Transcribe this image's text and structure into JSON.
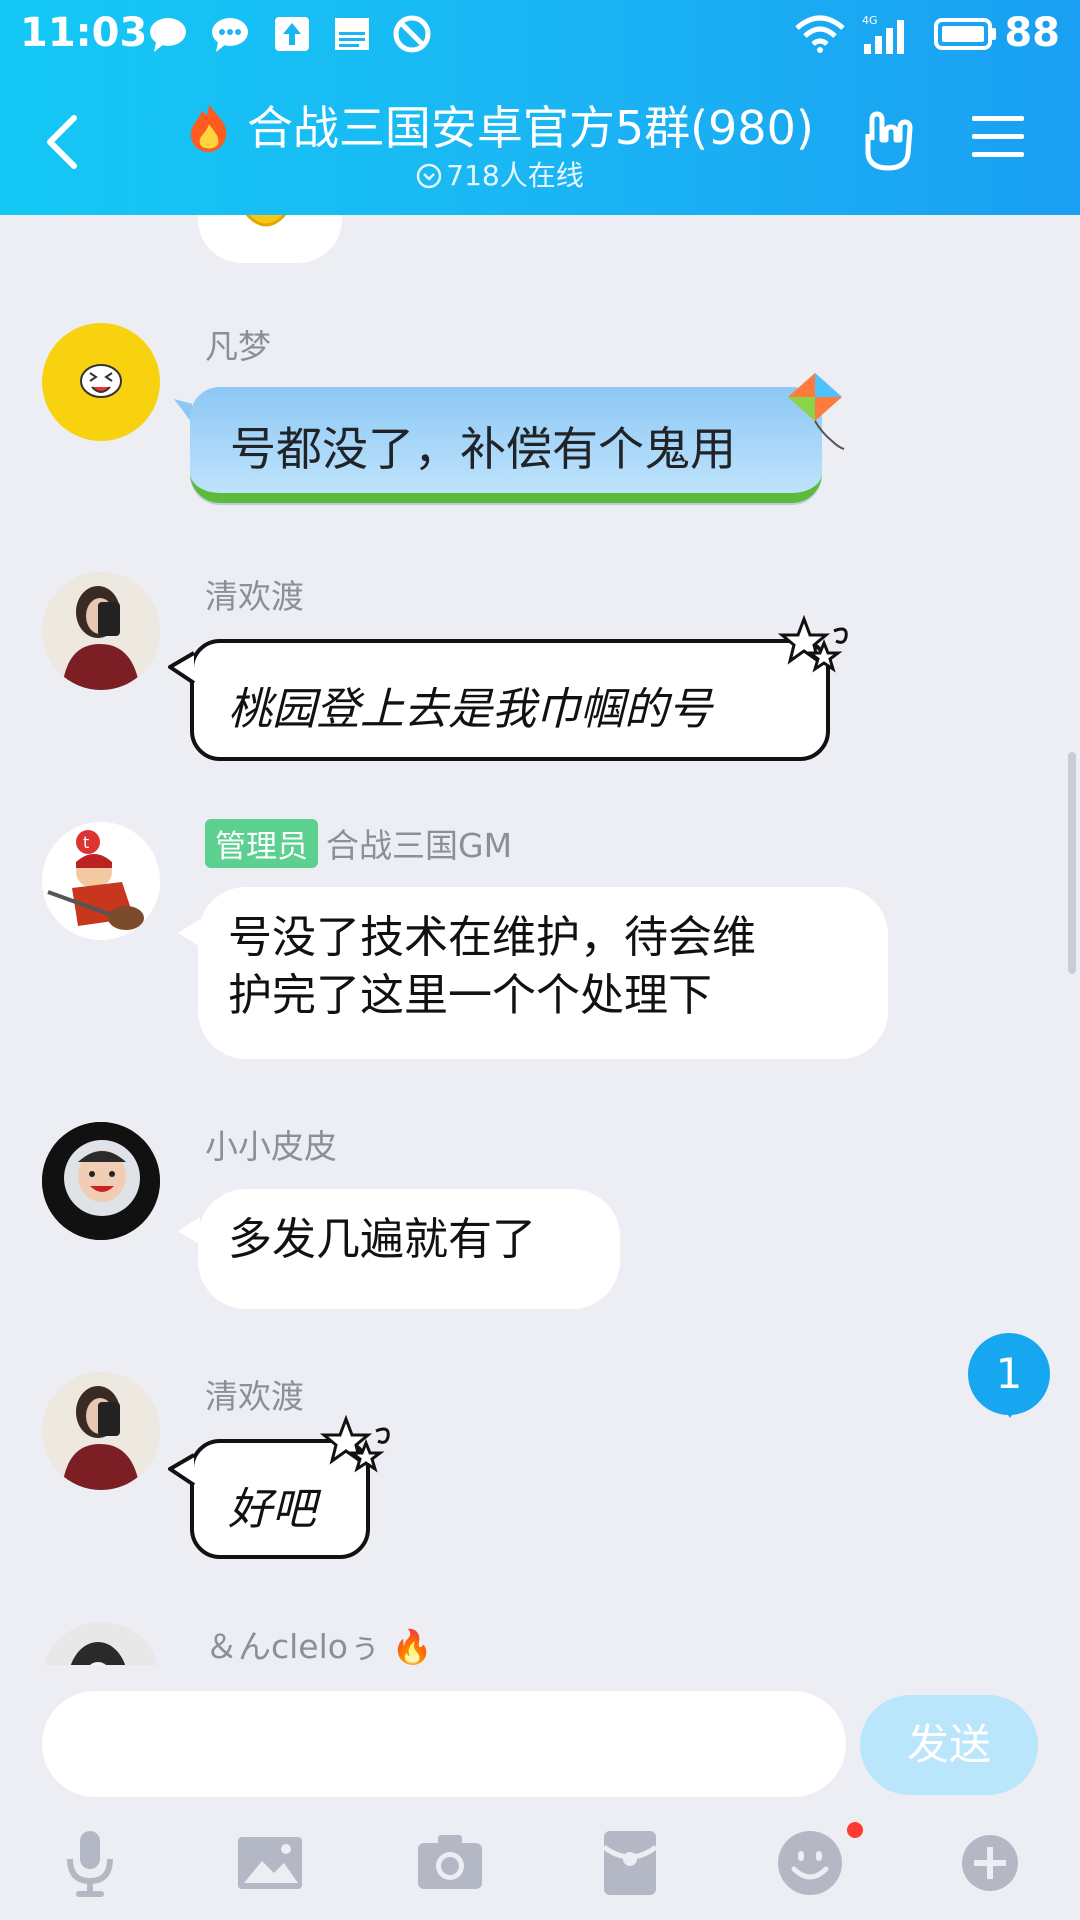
{
  "status_bar": {
    "time": "11:03",
    "battery": "88",
    "network": "4G"
  },
  "header": {
    "title": "合战三国安卓官方5群(980)",
    "online": "718人在线",
    "title_icon": "fire-emoji"
  },
  "messages": [
    {
      "sender": "凡梦",
      "text": "号都没了，补偿有个鬼用",
      "style": "sky-bubble"
    },
    {
      "sender": "清欢渡",
      "text": "桃园登上去是我巾帼的号",
      "style": "handwritten"
    },
    {
      "badge": "管理员",
      "sender": "合战三国GM",
      "text_line1": "号没了技术在维护，待会维",
      "text_line2": "护完了这里一个个处理下",
      "style": "default"
    },
    {
      "sender": "小小皮皮",
      "text": "多发几遍就有了",
      "style": "default"
    },
    {
      "sender": "清欢渡",
      "text": "好吧",
      "style": "handwritten"
    },
    {
      "sender": "＆んcleloぅ",
      "sender_suffix": "🔥"
    }
  ],
  "unread_count": "1",
  "input": {
    "placeholder": "",
    "value": ""
  },
  "send_label": "发送",
  "toolbar": [
    "mic-icon",
    "image-icon",
    "camera-icon",
    "red-packet-icon",
    "emoji-icon",
    "plus-icon"
  ],
  "colors": {
    "header": "#1ab6f4",
    "admin": "#5cd08e",
    "send": "#b9e6fb",
    "badge": "#16a7f0"
  }
}
